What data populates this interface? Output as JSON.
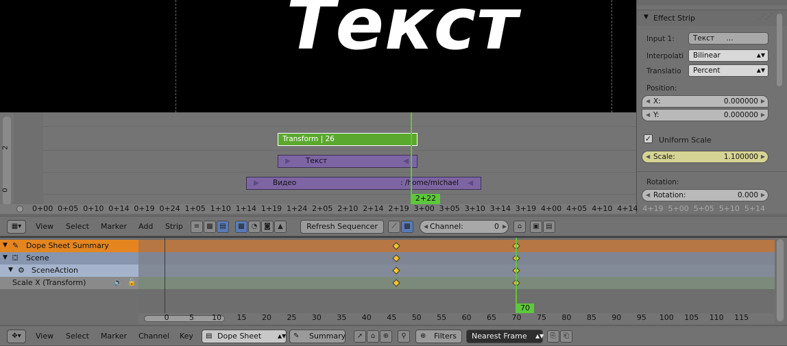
{
  "preview": {
    "text": "Текст"
  },
  "properties": {
    "effect_strip_title": "Effect Strip",
    "input_label": "Input 1:",
    "input_value": "Текст",
    "input_ellipsis": "...",
    "interpolation_label": "Interpolati",
    "interpolation_value": "Bilinear",
    "translation_label": "Translatio",
    "translation_value": "Percent",
    "position_label": "Position:",
    "x_label": "X:",
    "x_value": "0.000000",
    "y_label": "Y:",
    "y_value": "0.000000",
    "uniform_scale_label": "Uniform Scale",
    "uniform_scale_checked": true,
    "scale_label": "Scale:",
    "scale_value": "1.100000",
    "rotation_section": "Rotation:",
    "rotation_label": "Rotation:",
    "rotation_value": "0.000"
  },
  "sequencer": {
    "channel_numbers": [
      "2",
      "0"
    ],
    "strips": [
      {
        "name": "Transform | 26"
      },
      {
        "name": "Текст"
      },
      {
        "name": "Видео",
        "path": ": /home/michael"
      }
    ],
    "current_frame": "2+22",
    "timeline_ticks": [
      "0+00",
      "0+05",
      "0+10",
      "0+14",
      "0+19",
      "0+24",
      "1+05",
      "1+10",
      "1+14",
      "1+19",
      "1+24",
      "2+05",
      "2+10",
      "2+14",
      "2+19",
      "3+00",
      "3+05",
      "3+10",
      "3+14",
      "3+19",
      "4+00",
      "4+05",
      "4+10",
      "4+14",
      "4+19",
      "5+00",
      "5+05",
      "5+10",
      "5+14"
    ]
  },
  "seq_header": {
    "menus": [
      "View",
      "Select",
      "Marker",
      "Add",
      "Strip"
    ],
    "refresh_label": "Refresh Sequencer",
    "channel_label": "Channel:",
    "channel_value": "0"
  },
  "dopesheet": {
    "rows": [
      "Dope Sheet Summary",
      "Scene",
      "SceneAction",
      "Scale X (Transform)"
    ],
    "current_frame": "70",
    "ticks": [
      "0",
      "5",
      "10",
      "15",
      "20",
      "25",
      "30",
      "35",
      "40",
      "45",
      "50",
      "55",
      "60",
      "65",
      "70",
      "75",
      "80",
      "85",
      "90",
      "95",
      "100",
      "105",
      "110",
      "115"
    ]
  },
  "ds_header": {
    "menus": [
      "View",
      "Select",
      "Marker",
      "Channel",
      "Key"
    ],
    "mode_value": "Dope Sheet",
    "summary_label": "Summary",
    "filters_label": "Filters",
    "snap_value": "Nearest Frame"
  }
}
